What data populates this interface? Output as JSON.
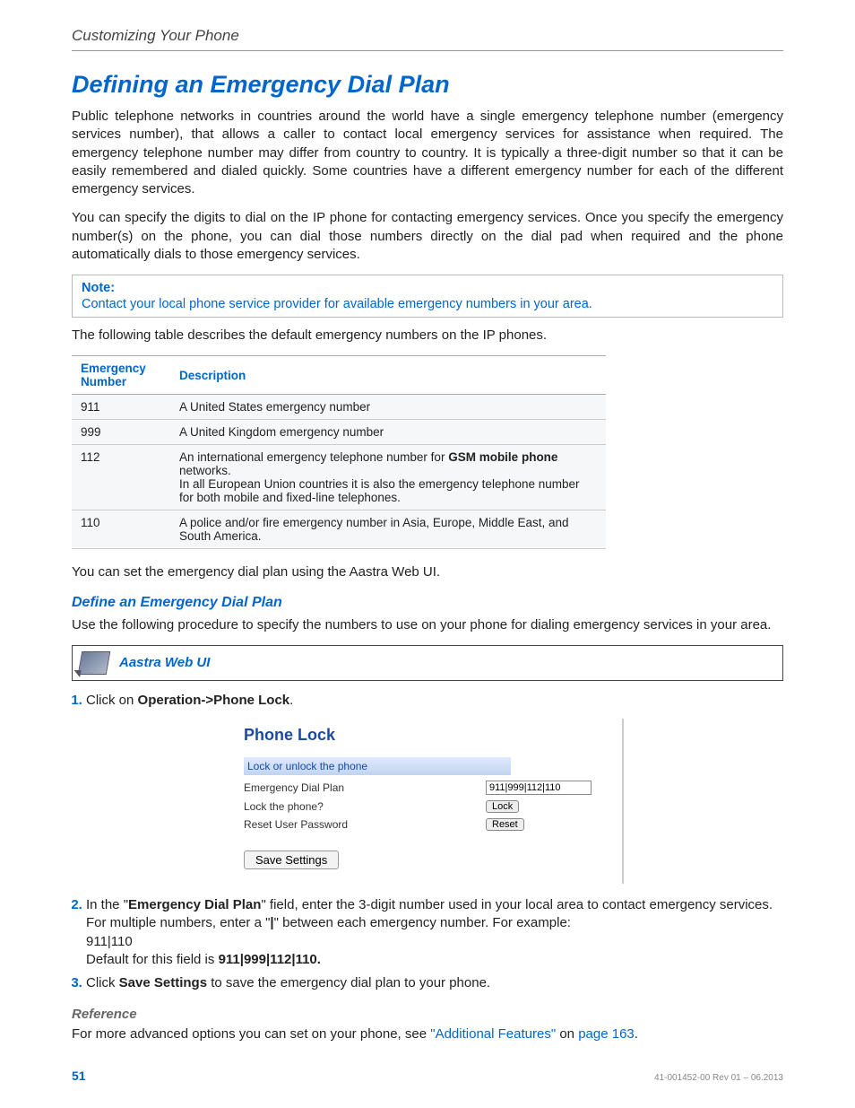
{
  "header": "Customizing Your Phone",
  "title": "Defining an Emergency Dial Plan",
  "para1": "Public telephone networks in countries around the world have a single emergency telephone number (emergency services number), that allows a caller to contact local emergency services for assistance when required. The emergency telephone number may differ from country to country. It is typically a three-digit number so that it can be easily remembered and dialed quickly. Some countries have a different emergency number for each of the different emergency services.",
  "para2": "You can specify the digits to dial on the IP phone for contacting emergency services. Once you specify the emergency number(s) on the phone, you can dial those numbers directly on the dial pad when required and the phone automatically dials to those emergency services.",
  "note": {
    "label": "Note:",
    "text": "Contact your local phone service provider for available emergency numbers in your area."
  },
  "para3": "The following table describes the default emergency numbers on the IP phones.",
  "table": {
    "headers": [
      "Emergency Number",
      "Description"
    ],
    "rows": [
      {
        "num": "911",
        "desc": "A United States emergency number"
      },
      {
        "num": "999",
        "desc": "A United Kingdom emergency number"
      },
      {
        "num": "112",
        "desc_pre": "An international emergency telephone number for ",
        "desc_bold": "GSM mobile phone",
        "desc_post": " networks.",
        "desc2": "In all European Union countries it is also the emergency telephone number for both mobile and fixed-line telephones."
      },
      {
        "num": "110",
        "desc": "A police and/or fire emergency number in Asia, Europe, Middle East, and South America."
      }
    ]
  },
  "para4": "You can set the emergency dial plan using the Aastra Web UI.",
  "sub1": "Define an Emergency Dial Plan",
  "para5": "Use the following procedure to specify the numbers to use on your phone for dialing emergency services in your area.",
  "webui_label": "Aastra Web UI",
  "step1": {
    "pre": "Click on ",
    "bold": "Operation->Phone Lock",
    "post": "."
  },
  "shot": {
    "title": "Phone Lock",
    "section": "Lock or unlock the phone",
    "row1_label": "Emergency Dial Plan",
    "row1_value": "911|999|112|110",
    "row2_label": "Lock the phone?",
    "row2_btn": "Lock",
    "row3_label": "Reset User Password",
    "row3_btn": "Reset",
    "save": "Save Settings"
  },
  "step2": {
    "pre": "In the \"",
    "bold1": "Emergency Dial Plan",
    "mid1": "\" field, enter the 3-digit number used in your local area to contact emergency services. For multiple numbers, enter a \"",
    "bold_pipe": "|",
    "mid2": "\" between each emergency number. For example:",
    "example": "911|110",
    "default_pre": "Default for this field is ",
    "default_bold": "911|999|112|110."
  },
  "step3": {
    "pre": "Click ",
    "bold": "Save Settings",
    "post": " to save the emergency dial plan to your phone."
  },
  "ref_title": "Reference",
  "ref": {
    "pre": "For more advanced options you can set on your phone, see ",
    "link1": "\"Additional Features\"",
    "mid": " on ",
    "link2": "page 163",
    "post": "."
  },
  "footer": {
    "page": "51",
    "rev": "41-001452-00 Rev 01 – 06.2013"
  }
}
